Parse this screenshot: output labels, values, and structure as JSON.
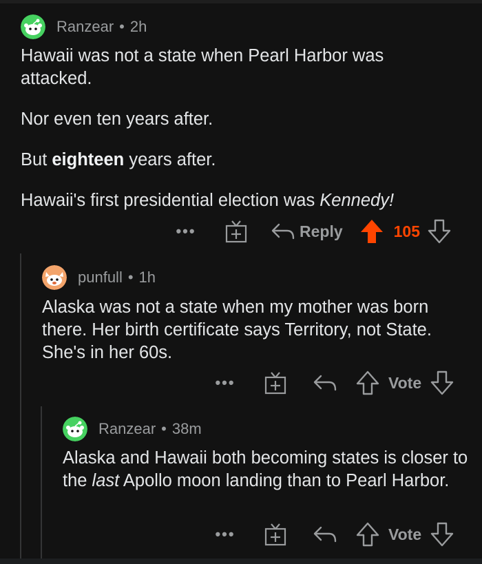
{
  "comments": [
    {
      "author": "Ranzear",
      "separator": "•",
      "time": "2h",
      "paragraphs": [
        {
          "text": "Hawaii was not a state when Pearl Harbor was attacked."
        },
        {
          "text": "Nor even ten years after."
        },
        {
          "pre": "But ",
          "bold": "eighteen",
          "post": " years after."
        },
        {
          "pre": "Hawaii's first presidential election was ",
          "italic": "Kennedy!"
        }
      ],
      "actions": {
        "more": "•••",
        "award_icon": "gift-icon",
        "reply_label": "Reply",
        "vote_count": "105",
        "upvoted": true,
        "upvote_color": "#ff4500"
      }
    },
    {
      "author": "punfull",
      "separator": "•",
      "time": "1h",
      "paragraphs": [
        {
          "text": "Alaska was not a state when my mother was born there. Her birth certificate says Territory, not State. She's in her 60s."
        }
      ],
      "actions": {
        "more": "•••",
        "award_icon": "gift-icon",
        "vote_label": "Vote"
      }
    },
    {
      "author": "Ranzear",
      "separator": "•",
      "time": "38m",
      "paragraphs": [
        {
          "pre": "Alaska and Hawaii both becoming states is closer to the ",
          "italic": "last",
          "post": " Apollo moon landing than to Pearl Harbor."
        }
      ],
      "actions": {
        "more": "•••",
        "award_icon": "gift-icon",
        "vote_label": "Vote"
      }
    }
  ]
}
